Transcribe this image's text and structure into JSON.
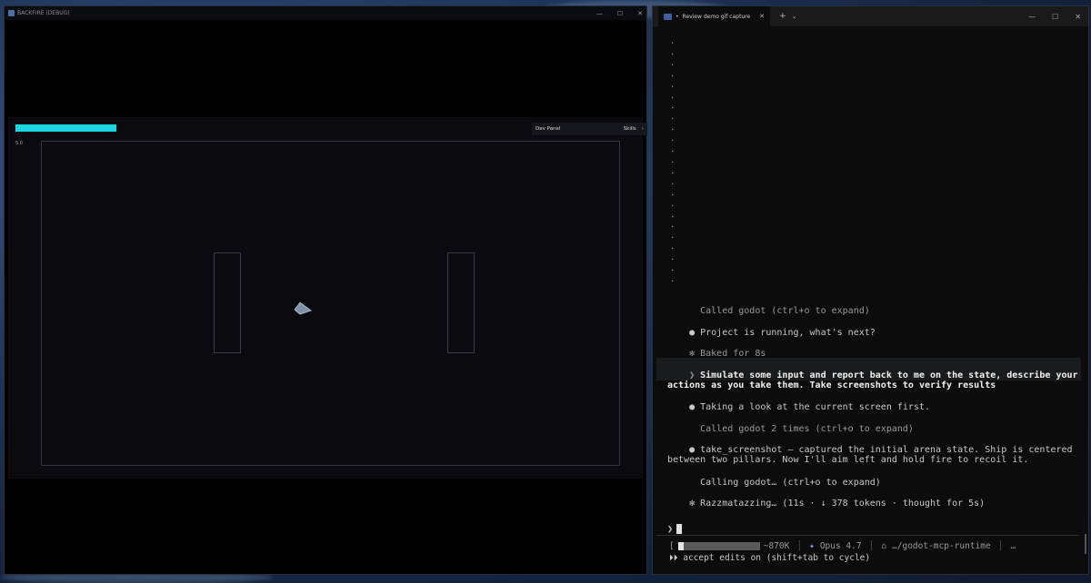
{
  "game_window": {
    "title": "BACKFIRE (DEBUG)",
    "controls": [
      "—",
      "☐",
      "✕"
    ],
    "health_fraction": 1.0,
    "dev_panel": {
      "title": "Dev Panel",
      "skills_label": "Skills",
      "skills_arrow": "›"
    },
    "score": "5.0"
  },
  "terminal": {
    "tab_title": "Review demo gif capture",
    "tab_prefix": "•",
    "tab_close": "✕",
    "tab_add": "+",
    "tab_dropdown": "⌄",
    "controls": [
      "—",
      "☐",
      "✕"
    ],
    "dot": ".",
    "lines": [
      {
        "marker": "",
        "text": "Called godot (ctrl+o to expand)",
        "style": "dim"
      },
      {
        "marker": "●",
        "text": "Project is running, what's next?",
        "style": "normal"
      },
      {
        "marker": "✻",
        "text": "Baked for 8s",
        "style": "dim"
      },
      {
        "marker": "❯",
        "text": "Simulate some input and report back to me on the state, describe your\nactions as you take them. Take screenshots to verify results",
        "style": "bright"
      },
      {
        "marker": "●",
        "text": "Taking a look at the current screen first.",
        "style": "normal"
      },
      {
        "marker": "",
        "text": "Called godot 2 times (ctrl+o to expand)",
        "style": "dim"
      },
      {
        "marker": "●",
        "text": "take_screenshot — captured the initial arena state. Ship is centered\nbetween two pillars. Now I'll aim left and hold fire to recoil it.",
        "style": "normal"
      },
      {
        "marker": "",
        "text": "Calling godot… (ctrl+o to expand)",
        "style": "dim"
      },
      {
        "marker": "✻",
        "text": "Razzmatazzing… (11s · ↓ 378 tokens · thought for 5s)",
        "style": "normal"
      }
    ],
    "prompt_symbol": "❯",
    "status": {
      "context_prefix": "[",
      "context_tokens": "~870K",
      "model_icon": "✦",
      "model": "Opus 4.7",
      "folder_icon": "⌂",
      "path": "…/godot-mcp-runtime",
      "more": "…",
      "separator": "│"
    },
    "accept_edits": "⏵⏵ accept edits on (shift+tab to cycle)"
  }
}
